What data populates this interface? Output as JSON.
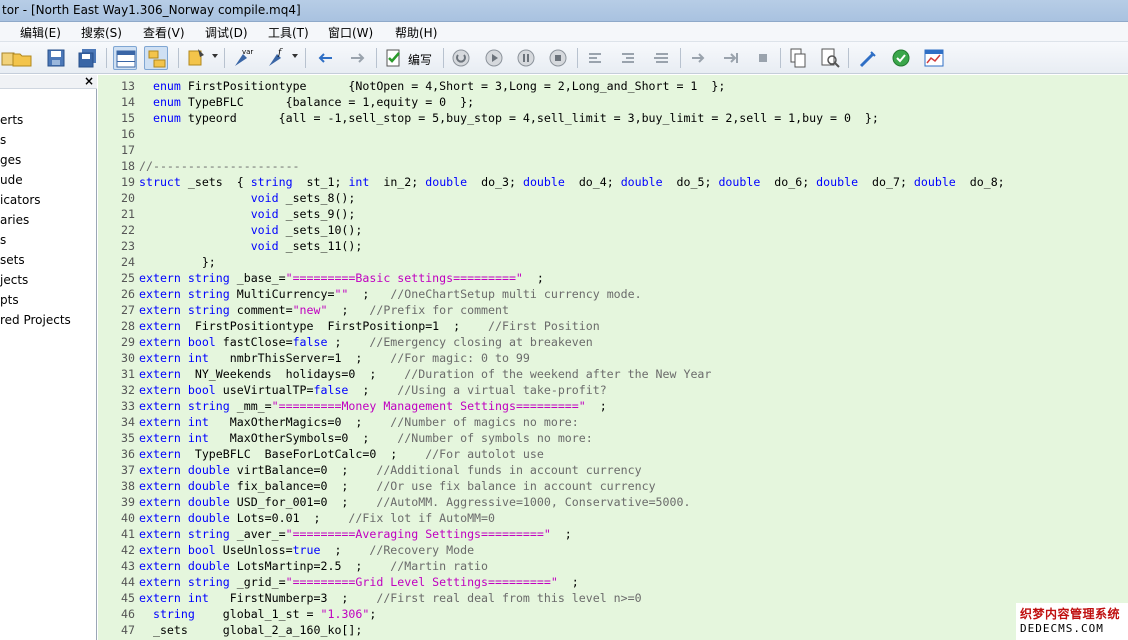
{
  "window": {
    "title": "tor - [North East Way1.306_Norway compile.mq4]"
  },
  "menu": [
    "编辑(E)",
    "搜索(S)",
    "查看(V)",
    "调试(D)",
    "工具(T)",
    "窗口(W)",
    "帮助(H)"
  ],
  "toolbar": {
    "compile_label": "编写",
    "buttons": [
      "new-file-icon",
      "open-folder-icon",
      "save-icon",
      "save-all-icon",
      "layout-icon",
      "navigator-icon",
      "wizard-icon",
      "var-icon",
      "function-icon",
      "back-arrow-icon",
      "forward-arrow-icon",
      "compile-icon",
      "stop-icon",
      "play-icon",
      "pause-icon",
      "stop-square-icon",
      "debug-icon-1",
      "debug-icon-2",
      "debug-icon-3",
      "step-icon-1",
      "step-icon-2",
      "step-icon-3",
      "copy-icon",
      "find-icon",
      "brush-icon",
      "check-shield-icon",
      "chart-window-icon"
    ],
    "accent": "#cfe0f3"
  },
  "navigator": {
    "close_label": "×",
    "items": [
      "erts",
      "s",
      "ges",
      "ude",
      "icators",
      "aries",
      "s",
      "sets",
      "jects",
      "pts",
      "red Projects"
    ]
  },
  "editor": {
    "background": "#e5f6dd",
    "lines": [
      {
        "n": "13",
        "segs": [
          [
            "  ",
            ""
          ],
          [
            "enum",
            "kw"
          ],
          [
            " FirstPositiontype      {NotOpen = 4,Short = 3,Long = 2,Long_and_Short = 1  };",
            ""
          ]
        ]
      },
      {
        "n": "14",
        "segs": [
          [
            "  ",
            ""
          ],
          [
            "enum",
            "kw"
          ],
          [
            " TypeBFLC      {balance = 1,equity = 0  };",
            ""
          ]
        ]
      },
      {
        "n": "15",
        "segs": [
          [
            "  ",
            ""
          ],
          [
            "enum",
            "kw"
          ],
          [
            " typeord      {all = -1,sell_stop = 5,buy_stop = 4,sell_limit = 3,buy_limit = 2,sell = 1,buy = 0  };",
            ""
          ]
        ]
      },
      {
        "n": "16",
        "segs": []
      },
      {
        "n": "17",
        "segs": []
      },
      {
        "n": "18",
        "segs": [
          [
            "//---------------------",
            "com"
          ]
        ]
      },
      {
        "n": "19",
        "segs": [
          [
            "struct",
            "kw"
          ],
          [
            " _sets  { ",
            ""
          ],
          [
            "string",
            "kw"
          ],
          [
            "  st_1; ",
            ""
          ],
          [
            "int",
            "kw"
          ],
          [
            "  in_2; ",
            ""
          ],
          [
            "double",
            "kw"
          ],
          [
            "  do_3; ",
            ""
          ],
          [
            "double",
            "kw"
          ],
          [
            "  do_4; ",
            ""
          ],
          [
            "double",
            "kw"
          ],
          [
            "  do_5; ",
            ""
          ],
          [
            "double",
            "kw"
          ],
          [
            "  do_6; ",
            ""
          ],
          [
            "double",
            "kw"
          ],
          [
            "  do_7; ",
            ""
          ],
          [
            "double",
            "kw"
          ],
          [
            "  do_8;",
            ""
          ]
        ]
      },
      {
        "n": "20",
        "segs": [
          [
            "                ",
            ""
          ],
          [
            "void",
            "kw"
          ],
          [
            " _sets_8();",
            ""
          ]
        ]
      },
      {
        "n": "21",
        "segs": [
          [
            "                ",
            ""
          ],
          [
            "void",
            "kw"
          ],
          [
            " _sets_9();",
            ""
          ]
        ]
      },
      {
        "n": "22",
        "segs": [
          [
            "                ",
            ""
          ],
          [
            "void",
            "kw"
          ],
          [
            " _sets_10();",
            ""
          ]
        ]
      },
      {
        "n": "23",
        "segs": [
          [
            "                ",
            ""
          ],
          [
            "void",
            "kw"
          ],
          [
            " _sets_11();",
            ""
          ]
        ]
      },
      {
        "n": "24",
        "segs": [
          [
            "         };",
            ""
          ]
        ]
      },
      {
        "n": "25",
        "segs": [
          [
            "extern string",
            "kw"
          ],
          [
            " _base_=",
            ""
          ],
          [
            "\"=========Basic settings=========\"",
            "str"
          ],
          [
            "  ;",
            ""
          ]
        ]
      },
      {
        "n": "26",
        "segs": [
          [
            "extern string",
            "kw"
          ],
          [
            " MultiCurrency=",
            ""
          ],
          [
            "\"\"",
            "str"
          ],
          [
            "  ;   ",
            ""
          ],
          [
            "//OneChartSetup multi currency mode.",
            "com"
          ]
        ]
      },
      {
        "n": "27",
        "segs": [
          [
            "extern string",
            "kw"
          ],
          [
            " comment=",
            ""
          ],
          [
            "\"new\"",
            "str"
          ],
          [
            "  ;   ",
            ""
          ],
          [
            "//Prefix for comment",
            "com"
          ]
        ]
      },
      {
        "n": "28",
        "segs": [
          [
            "extern",
            "kw"
          ],
          [
            "  FirstPositiontype  FirstPositionp=1  ;    ",
            ""
          ],
          [
            "//First Position",
            "com"
          ]
        ]
      },
      {
        "n": "29",
        "segs": [
          [
            "extern bool",
            "kw"
          ],
          [
            " fastClose=",
            ""
          ],
          [
            "false",
            "kw"
          ],
          [
            " ;    ",
            ""
          ],
          [
            "//Emergency closing at breakeven",
            "com"
          ]
        ]
      },
      {
        "n": "30",
        "segs": [
          [
            "extern int",
            "kw"
          ],
          [
            "   nmbrThisServer=1  ;    ",
            ""
          ],
          [
            "//For magic: 0 to 99",
            "com"
          ]
        ]
      },
      {
        "n": "31",
        "segs": [
          [
            "extern",
            "kw"
          ],
          [
            "  NY_Weekends  holidays=0  ;    ",
            ""
          ],
          [
            "//Duration of the weekend after the New Year",
            "com"
          ]
        ]
      },
      {
        "n": "32",
        "segs": [
          [
            "extern bool",
            "kw"
          ],
          [
            " useVirtualTP=",
            ""
          ],
          [
            "false",
            "kw"
          ],
          [
            "  ;    ",
            ""
          ],
          [
            "//Using a virtual take-profit?",
            "com"
          ]
        ]
      },
      {
        "n": "33",
        "segs": [
          [
            "extern string",
            "kw"
          ],
          [
            " _mm_=",
            ""
          ],
          [
            "\"=========Money Management Settings=========\"",
            "str"
          ],
          [
            "  ;",
            ""
          ]
        ]
      },
      {
        "n": "34",
        "segs": [
          [
            "extern int",
            "kw"
          ],
          [
            "   MaxOtherMagics=0  ;    ",
            ""
          ],
          [
            "//Number of magics no more:",
            "com"
          ]
        ]
      },
      {
        "n": "35",
        "segs": [
          [
            "extern int",
            "kw"
          ],
          [
            "   MaxOtherSymbols=0  ;    ",
            ""
          ],
          [
            "//Number of symbols no more:",
            "com"
          ]
        ]
      },
      {
        "n": "36",
        "segs": [
          [
            "extern",
            "kw"
          ],
          [
            "  TypeBFLC  BaseForLotCalc=0  ;    ",
            ""
          ],
          [
            "//For autolot use",
            "com"
          ]
        ]
      },
      {
        "n": "37",
        "segs": [
          [
            "extern double",
            "kw"
          ],
          [
            " virtBalance=0  ;    ",
            ""
          ],
          [
            "//Additional funds in account currency",
            "com"
          ]
        ]
      },
      {
        "n": "38",
        "segs": [
          [
            "extern double",
            "kw"
          ],
          [
            " fix_balance=0  ;    ",
            ""
          ],
          [
            "//Or use fix balance in account currency",
            "com"
          ]
        ]
      },
      {
        "n": "39",
        "segs": [
          [
            "extern double",
            "kw"
          ],
          [
            " USD_for_001=0  ;    ",
            ""
          ],
          [
            "//AutoMM. Aggressive=1000, Conservative=5000.",
            "com"
          ]
        ]
      },
      {
        "n": "40",
        "segs": [
          [
            "extern double",
            "kw"
          ],
          [
            " Lots=0.01  ;    ",
            ""
          ],
          [
            "//Fix lot if AutoMM=0",
            "com"
          ]
        ]
      },
      {
        "n": "41",
        "segs": [
          [
            "extern string",
            "kw"
          ],
          [
            " _aver_=",
            ""
          ],
          [
            "\"=========Averaging Settings=========\"",
            "str"
          ],
          [
            "  ;",
            ""
          ]
        ]
      },
      {
        "n": "42",
        "segs": [
          [
            "extern bool",
            "kw"
          ],
          [
            " UseUnloss=",
            ""
          ],
          [
            "true",
            "kw"
          ],
          [
            "  ;    ",
            ""
          ],
          [
            "//Recovery Mode",
            "com"
          ]
        ]
      },
      {
        "n": "43",
        "segs": [
          [
            "extern double",
            "kw"
          ],
          [
            " LotsMartinp=2.5  ;    ",
            ""
          ],
          [
            "//Martin ratio",
            "com"
          ]
        ]
      },
      {
        "n": "44",
        "segs": [
          [
            "extern string",
            "kw"
          ],
          [
            " _grid_=",
            ""
          ],
          [
            "\"=========Grid Level Settings=========\"",
            "str"
          ],
          [
            "  ;",
            ""
          ]
        ]
      },
      {
        "n": "45",
        "segs": [
          [
            "extern int",
            "kw"
          ],
          [
            "   FirstNumberp=3  ;    ",
            ""
          ],
          [
            "//First real deal from this level n>=0",
            "com"
          ]
        ]
      },
      {
        "n": "46",
        "segs": [
          [
            "  ",
            ""
          ],
          [
            "string",
            "kw"
          ],
          [
            "    global_1_st = ",
            ""
          ],
          [
            "\"1.306\"",
            "str"
          ],
          [
            ";",
            ""
          ]
        ]
      },
      {
        "n": "47",
        "segs": [
          [
            "  _sets     global_2_a_160_ko[];",
            ""
          ]
        ]
      }
    ]
  },
  "watermark": {
    "cn": "织梦内容管理系统",
    "en": "DEDECMS.COM"
  }
}
